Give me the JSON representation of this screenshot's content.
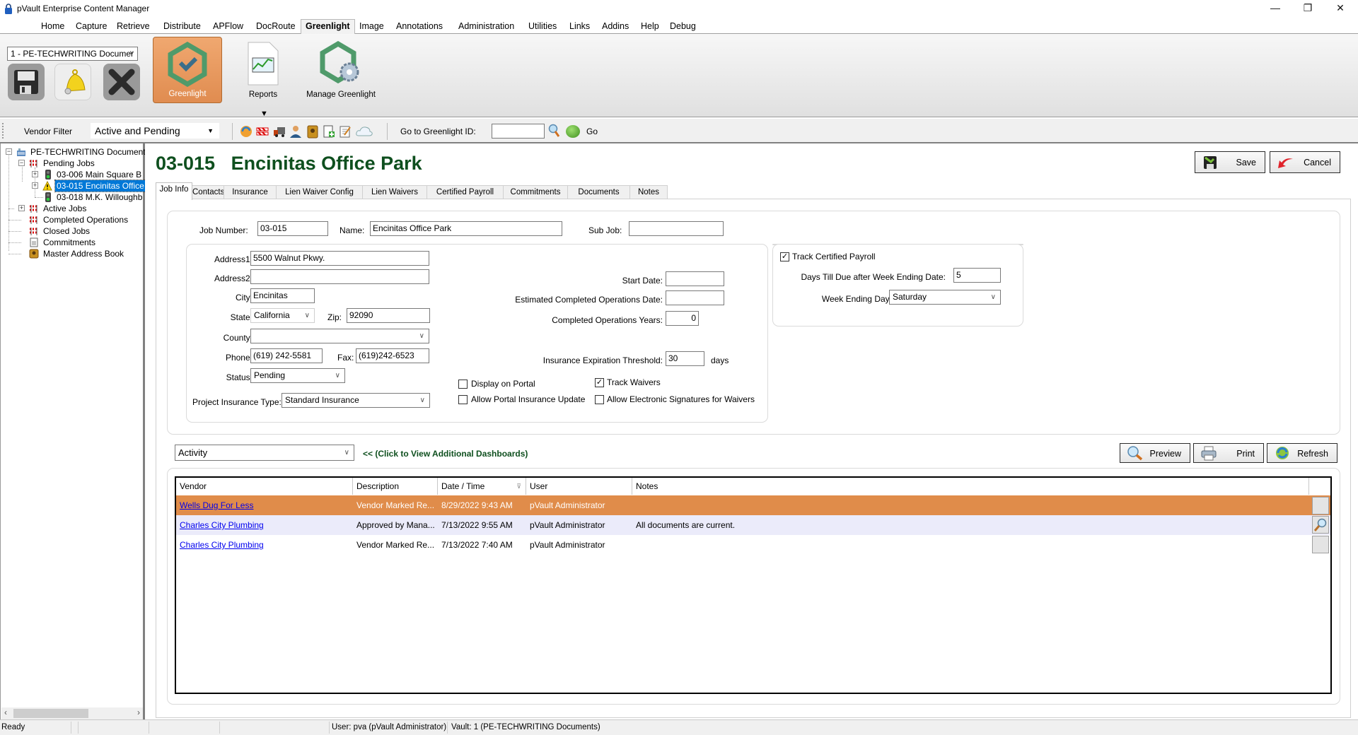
{
  "window": {
    "title": "pVault Enterprise Content Manager",
    "controls": [
      "—",
      "❐",
      "✕"
    ]
  },
  "menu": {
    "items": [
      "Home",
      "Capture",
      "Retrieve",
      "Distribute",
      "APFlow",
      "DocRoute",
      "Greenlight",
      "Image",
      "Annotations",
      "Administration",
      "Utilities",
      "Links",
      "Addins",
      "Help",
      "Debug"
    ],
    "active": "Greenlight"
  },
  "ribbon": {
    "vault_select": "1 - PE-TECHWRITING Documer",
    "small_buttons": [
      "save-icon",
      "bell-icon",
      "close-x-icon"
    ],
    "large_buttons": [
      {
        "label": "Greenlight",
        "icon": "greenlight-logo-icon",
        "active": true
      },
      {
        "label": "Reports",
        "icon": "report-chart-icon",
        "active": false,
        "dropdown": "▼"
      },
      {
        "label": "Manage Greenlight",
        "icon": "greenlight-gear-icon",
        "active": false
      }
    ]
  },
  "toolbar": {
    "vendor_filter_label": "Vendor Filter",
    "vendor_filter_value": "Active and Pending",
    "icons": [
      "refresh-globe-icon",
      "barricade-icon",
      "truck-icon",
      "user-icon",
      "address-book-icon",
      "add-document-icon",
      "notepad-icon",
      "cloud-icon"
    ],
    "goto_label": "Go to Greenlight ID:",
    "goto_value": "",
    "go_label": "Go"
  },
  "tree": {
    "root": "PE-TECHWRITING Documents",
    "nodes": [
      {
        "label": "Pending Jobs",
        "level": 1,
        "toggle": "−"
      },
      {
        "label": "03-006  Main Square B",
        "level": 2,
        "toggle": "+"
      },
      {
        "label": "03-015  Encinitas Office",
        "level": 2,
        "toggle": "+",
        "selected": true
      },
      {
        "label": "03-018  M.K. Willoughb",
        "level": 2,
        "toggle": ""
      },
      {
        "label": "Active Jobs",
        "level": 1,
        "toggle": "+"
      },
      {
        "label": "Completed Operations",
        "level": 1,
        "toggle": ""
      },
      {
        "label": "Closed Jobs",
        "level": 1,
        "toggle": ""
      },
      {
        "label": "Commitments",
        "level": 1,
        "toggle": ""
      },
      {
        "label": "Master Address Book",
        "level": 1,
        "toggle": ""
      }
    ]
  },
  "job": {
    "heading": "03-015   Encinitas Office Park",
    "save_label": "Save",
    "cancel_label": "Cancel",
    "tabs": [
      "Job Info",
      "Contacts",
      "Insurance",
      "Lien Waiver Config",
      "Lien Waivers",
      "Certified Payroll",
      "Commitments",
      "Documents",
      "Notes"
    ],
    "active_tab": "Job Info"
  },
  "form": {
    "job_number_label": "Job Number:",
    "job_number": "03-015",
    "name_label": "Name:",
    "name": "Encinitas Office Park",
    "sub_job_label": "Sub Job:",
    "sub_job": "",
    "address1_label": "Address1:",
    "address1": "5500 Walnut Pkwy.",
    "address2_label": "Address2:",
    "address2": "",
    "city_label": "City:",
    "city": "Encinitas",
    "state_label": "State:",
    "state": "California",
    "zip_label": "Zip:",
    "zip": "92090",
    "county_label": "County:",
    "county": "",
    "phone_label": "Phone:",
    "phone": "(619) 242-5581",
    "fax_label": "Fax:",
    "fax": "(619)242-6523",
    "status_label": "Status:",
    "status": "Pending",
    "insurance_type_label": "Project Insurance Type:",
    "insurance_type": "Standard Insurance",
    "start_date_label": "Start Date:",
    "start_date": "",
    "est_completed_label": "Estimated Completed Operations Date:",
    "est_completed": "",
    "completed_years_label": "Completed Operations Years:",
    "completed_years": "0",
    "ins_threshold_label": "Insurance Expiration Threshold:",
    "ins_threshold": "30",
    "ins_threshold_unit": "days",
    "display_portal_label": "Display on Portal",
    "display_portal": false,
    "allow_portal_ins_label": "Allow Portal Insurance Update",
    "allow_portal_ins": false,
    "track_waivers_label": "Track Waivers",
    "track_waivers": true,
    "allow_esig_label": "Allow Electronic Signatures for Waivers",
    "allow_esig": false,
    "track_payroll_label": "Track Certified Payroll",
    "track_payroll": true,
    "days_due_label": "Days Till Due after Week Ending Date:",
    "days_due": "5",
    "week_ending_label": "Week Ending Day:",
    "week_ending": "Saturday"
  },
  "dashboard": {
    "select": "Activity",
    "link": "<<  (Click to View Additional Dashboards)",
    "preview_label": "Preview",
    "print_label": "Print",
    "refresh_label": "Refresh",
    "columns": [
      "Vendor",
      "Description",
      "Date / Time",
      "User",
      "Notes"
    ],
    "sort_indicator": "⊽",
    "rows": [
      {
        "vendor": "Wells Dug For Less",
        "description": "Vendor Marked Re...",
        "datetime": "8/29/2022 9:43 AM",
        "user": "pVault Administrator",
        "notes": "",
        "highlight": true
      },
      {
        "vendor": "Charles City Plumbing",
        "description": "Approved by Mana...",
        "datetime": "7/13/2022 9:55 AM",
        "user": "pVault Administrator",
        "notes": "All documents are current.",
        "highlight": false
      },
      {
        "vendor": "Charles City Plumbing",
        "description": "Vendor Marked Re...",
        "datetime": "7/13/2022 7:40 AM",
        "user": "pVault Administrator",
        "notes": "",
        "highlight": false
      }
    ],
    "colors": {
      "highlight_row": "#e08c4a",
      "alt_row": "#ebebfa",
      "heading": "#0e4f1e",
      "link": "#0000ee"
    }
  },
  "statusbar": {
    "status": "Ready",
    "user": "User: pva (pVault Administrator)",
    "vault": "Vault: 1 (PE-TECHWRITING Documents)"
  }
}
